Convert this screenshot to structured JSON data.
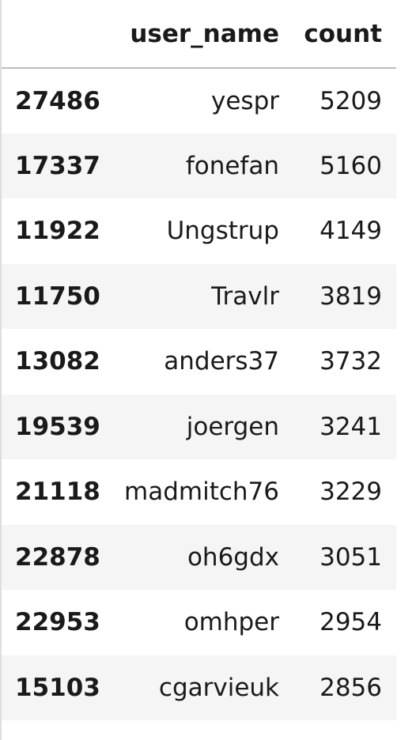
{
  "table": {
    "columns": [
      "",
      "user_name",
      "count"
    ],
    "rows": [
      {
        "index": "27486",
        "user_name": "yespr",
        "count": "5209"
      },
      {
        "index": "17337",
        "user_name": "fonefan",
        "count": "5160"
      },
      {
        "index": "11922",
        "user_name": "Ungstrup",
        "count": "4149"
      },
      {
        "index": "11750",
        "user_name": "Travlr",
        "count": "3819"
      },
      {
        "index": "13082",
        "user_name": "anders37",
        "count": "3732"
      },
      {
        "index": "19539",
        "user_name": "joergen",
        "count": "3241"
      },
      {
        "index": "21118",
        "user_name": "madmitch76",
        "count": "3229"
      },
      {
        "index": "22878",
        "user_name": "oh6gdx",
        "count": "3051"
      },
      {
        "index": "22953",
        "user_name": "omhper",
        "count": "2954"
      },
      {
        "index": "15103",
        "user_name": "cgarvieuk",
        "count": "2856"
      }
    ]
  }
}
